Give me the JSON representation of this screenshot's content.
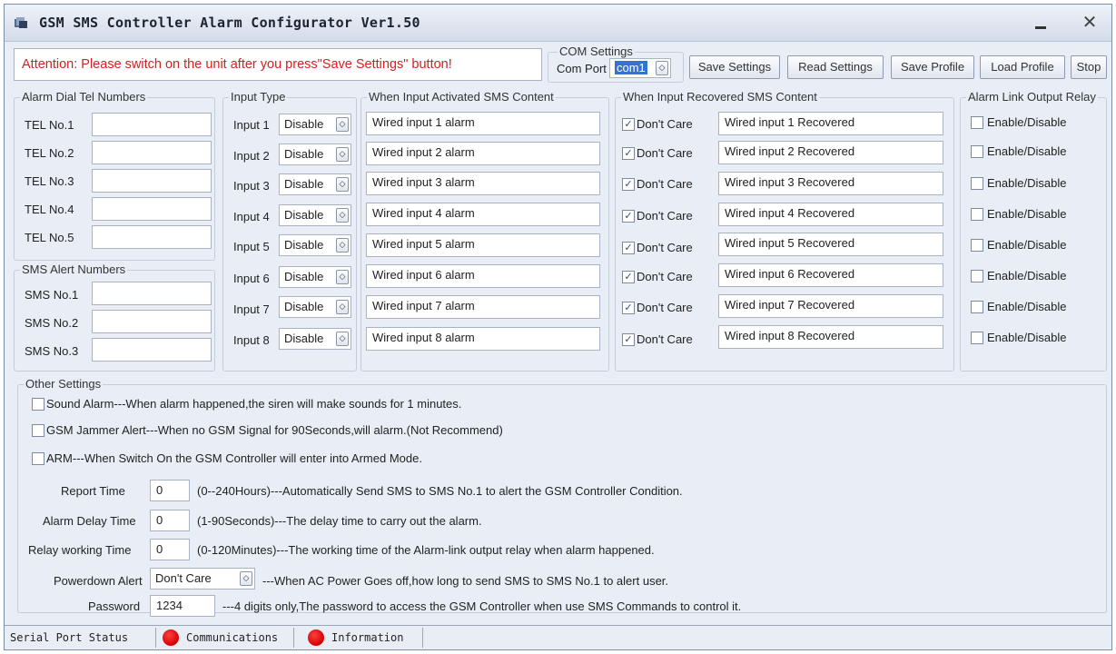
{
  "window": {
    "title": "GSM SMS Controller Alarm Configurator Ver1.50"
  },
  "attention": "Attention: Please switch on the unit after you press\"Save Settings\" button!",
  "com_settings": {
    "title": "COM Settings",
    "port_label": "Com Port",
    "port_value": "com1"
  },
  "toolbar": {
    "save_settings": "Save Settings",
    "read_settings": "Read Settings",
    "save_profile": "Save Profile",
    "load_profile": "Load Profile",
    "stop": "Stop"
  },
  "alarm_dial": {
    "title": "Alarm Dial Tel Numbers",
    "items": [
      {
        "label": "TEL No.1",
        "value": ""
      },
      {
        "label": "TEL No.2",
        "value": ""
      },
      {
        "label": "TEL No.3",
        "value": ""
      },
      {
        "label": "TEL No.4",
        "value": ""
      },
      {
        "label": "TEL No.5",
        "value": ""
      }
    ]
  },
  "sms_alert": {
    "title": "SMS Alert Numbers",
    "items": [
      {
        "label": "SMS No.1",
        "value": ""
      },
      {
        "label": "SMS No.2",
        "value": ""
      },
      {
        "label": "SMS No.3",
        "value": ""
      }
    ]
  },
  "input_type": {
    "title": "Input Type",
    "items": [
      {
        "label": "Input 1",
        "value": "Disable"
      },
      {
        "label": "Input 2",
        "value": "Disable"
      },
      {
        "label": "Input 3",
        "value": "Disable"
      },
      {
        "label": "Input 4",
        "value": "Disable"
      },
      {
        "label": "Input 5",
        "value": "Disable"
      },
      {
        "label": "Input 6",
        "value": "Disable"
      },
      {
        "label": "Input 7",
        "value": "Disable"
      },
      {
        "label": "Input 8",
        "value": "Disable"
      }
    ]
  },
  "activated": {
    "title": "When Input Activated SMS Content",
    "items": [
      "Wired input 1 alarm",
      "Wired input 2 alarm",
      "Wired input 3 alarm",
      "Wired input 4 alarm",
      "Wired input 5 alarm",
      "Wired input 6 alarm",
      "Wired input 7 alarm",
      "Wired input 8 alarm"
    ]
  },
  "recovered": {
    "title": "When Input Recovered SMS Content",
    "dont_care_label": "Don't Care",
    "dont_care_checked": [
      true,
      true,
      true,
      true,
      true,
      true,
      true,
      true
    ],
    "items": [
      "Wired input 1 Recovered",
      "Wired input 2 Recovered",
      "Wired input 3 Recovered",
      "Wired input 4 Recovered",
      "Wired input 5 Recovered",
      "Wired input 6 Recovered",
      "Wired input 7 Recovered",
      "Wired input 8 Recovered"
    ]
  },
  "relay": {
    "title": "Alarm Link Output Relay",
    "label": "Enable/Disable",
    "checked": [
      false,
      false,
      false,
      false,
      false,
      false,
      false,
      false
    ]
  },
  "other": {
    "title": "Other Settings",
    "sound_alarm": "Sound Alarm---When alarm happened,the siren will make sounds for 1 minutes.",
    "jammer": "GSM Jammer Alert---When no GSM Signal for 90Seconds,will alarm.(Not Recommend)",
    "arm": "ARM---When Switch On the GSM Controller will enter into Armed Mode.",
    "report_time": {
      "label": "Report Time",
      "value": "0",
      "desc": "(0--240Hours)---Automatically Send SMS to SMS No.1 to alert the GSM Controller Condition."
    },
    "alarm_delay": {
      "label": "Alarm Delay Time",
      "value": "0",
      "desc": "(1-90Seconds)---The delay time to carry out the alarm."
    },
    "relay_working": {
      "label": "Relay working Time",
      "value": "0",
      "desc": "(0-120Minutes)---The working time of the Alarm-link output relay when alarm happened."
    },
    "powerdown": {
      "label": "Powerdown Alert",
      "value": "Don't Care",
      "desc": "---When AC Power Goes off,how long to send SMS to SMS No.1 to alert user."
    },
    "password": {
      "label": "Password",
      "value": "1234",
      "desc": "---4 digits only,The password to access the GSM Controller when use SMS Commands to control it."
    }
  },
  "status": {
    "serial_port": "Serial Port Status",
    "communications": "Communications",
    "information": "Information",
    "led_color": "#e00000"
  }
}
